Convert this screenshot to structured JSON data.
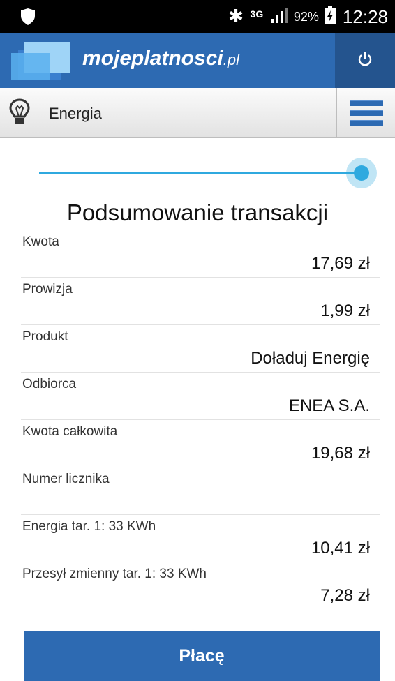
{
  "status_bar": {
    "network": "3G",
    "battery": "92%",
    "time": "12:28",
    "icons": [
      "shield-icon",
      "bluetooth-icon",
      "signal-icon",
      "battery-charging-icon"
    ]
  },
  "app": {
    "brand_main": "mojeplatnosci",
    "brand_tld": ".pl",
    "primary_color": "#2d6ab2",
    "accent_color": "#2fa9df"
  },
  "category": {
    "label": "Energia",
    "icon": "lightbulb-icon"
  },
  "progress": {
    "step": "complete",
    "value": 1.0
  },
  "summary": {
    "title": "Podsumowanie transakcji",
    "rows": [
      {
        "label": "Kwota",
        "value": "17,69 zł"
      },
      {
        "label": "Prowizja",
        "value": "1,99 zł"
      },
      {
        "label": "Produkt",
        "value": "Doładuj Energię"
      },
      {
        "label": "Odbiorca",
        "value": "ENEA S.A."
      },
      {
        "label": "Kwota całkowita",
        "value": "19,68 zł"
      },
      {
        "label": "Numer licznika",
        "value": ""
      },
      {
        "label": "Energia tar. 1: 33 KWh",
        "value": "10,41 zł"
      },
      {
        "label": "Przesył zmienny tar. 1: 33 KWh",
        "value": "7,28 zł"
      }
    ]
  },
  "pay_button": {
    "label": "Płacę"
  }
}
